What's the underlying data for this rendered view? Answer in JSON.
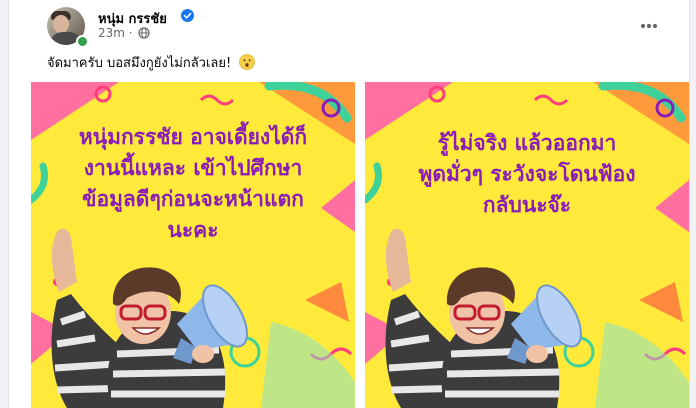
{
  "post": {
    "author": "หนุ่ม กรรชัย",
    "time": "23m",
    "caption": "จัดมาครับ บอสมึงกูยังไม่กลัวเลย!",
    "caption_emoji_icon": "hushed-face-emoji-icon"
  },
  "images": [
    {
      "lines": [
        "หนุ่มกรรชัย อาจเดี้ยงได้ก็",
        "งานนี้แหละ เข้าไปศึกษา",
        "ข้อมูลดีๆก่อนจะหน้าแตก",
        "นะคะ"
      ]
    },
    {
      "lines": [
        "รู้ไม่จริง แล้วออกมา",
        "พูดมั่วๆ ระวังจะโดนฟ้อง",
        "กลับนะจ๊ะ"
      ]
    }
  ],
  "colors": {
    "accent_blue": "#1877f2",
    "text_purple": "#8a1cb8",
    "background_yellow": "#ffe93a",
    "pink": "#ff6fa0",
    "orange": "#ff8a3d",
    "megaphone_blue": "#8fb8ea"
  },
  "icons": [
    "verified-badge-icon",
    "globe-icon",
    "more-options-icon",
    "hushed-face-emoji-icon",
    "megaphone-icon"
  ]
}
